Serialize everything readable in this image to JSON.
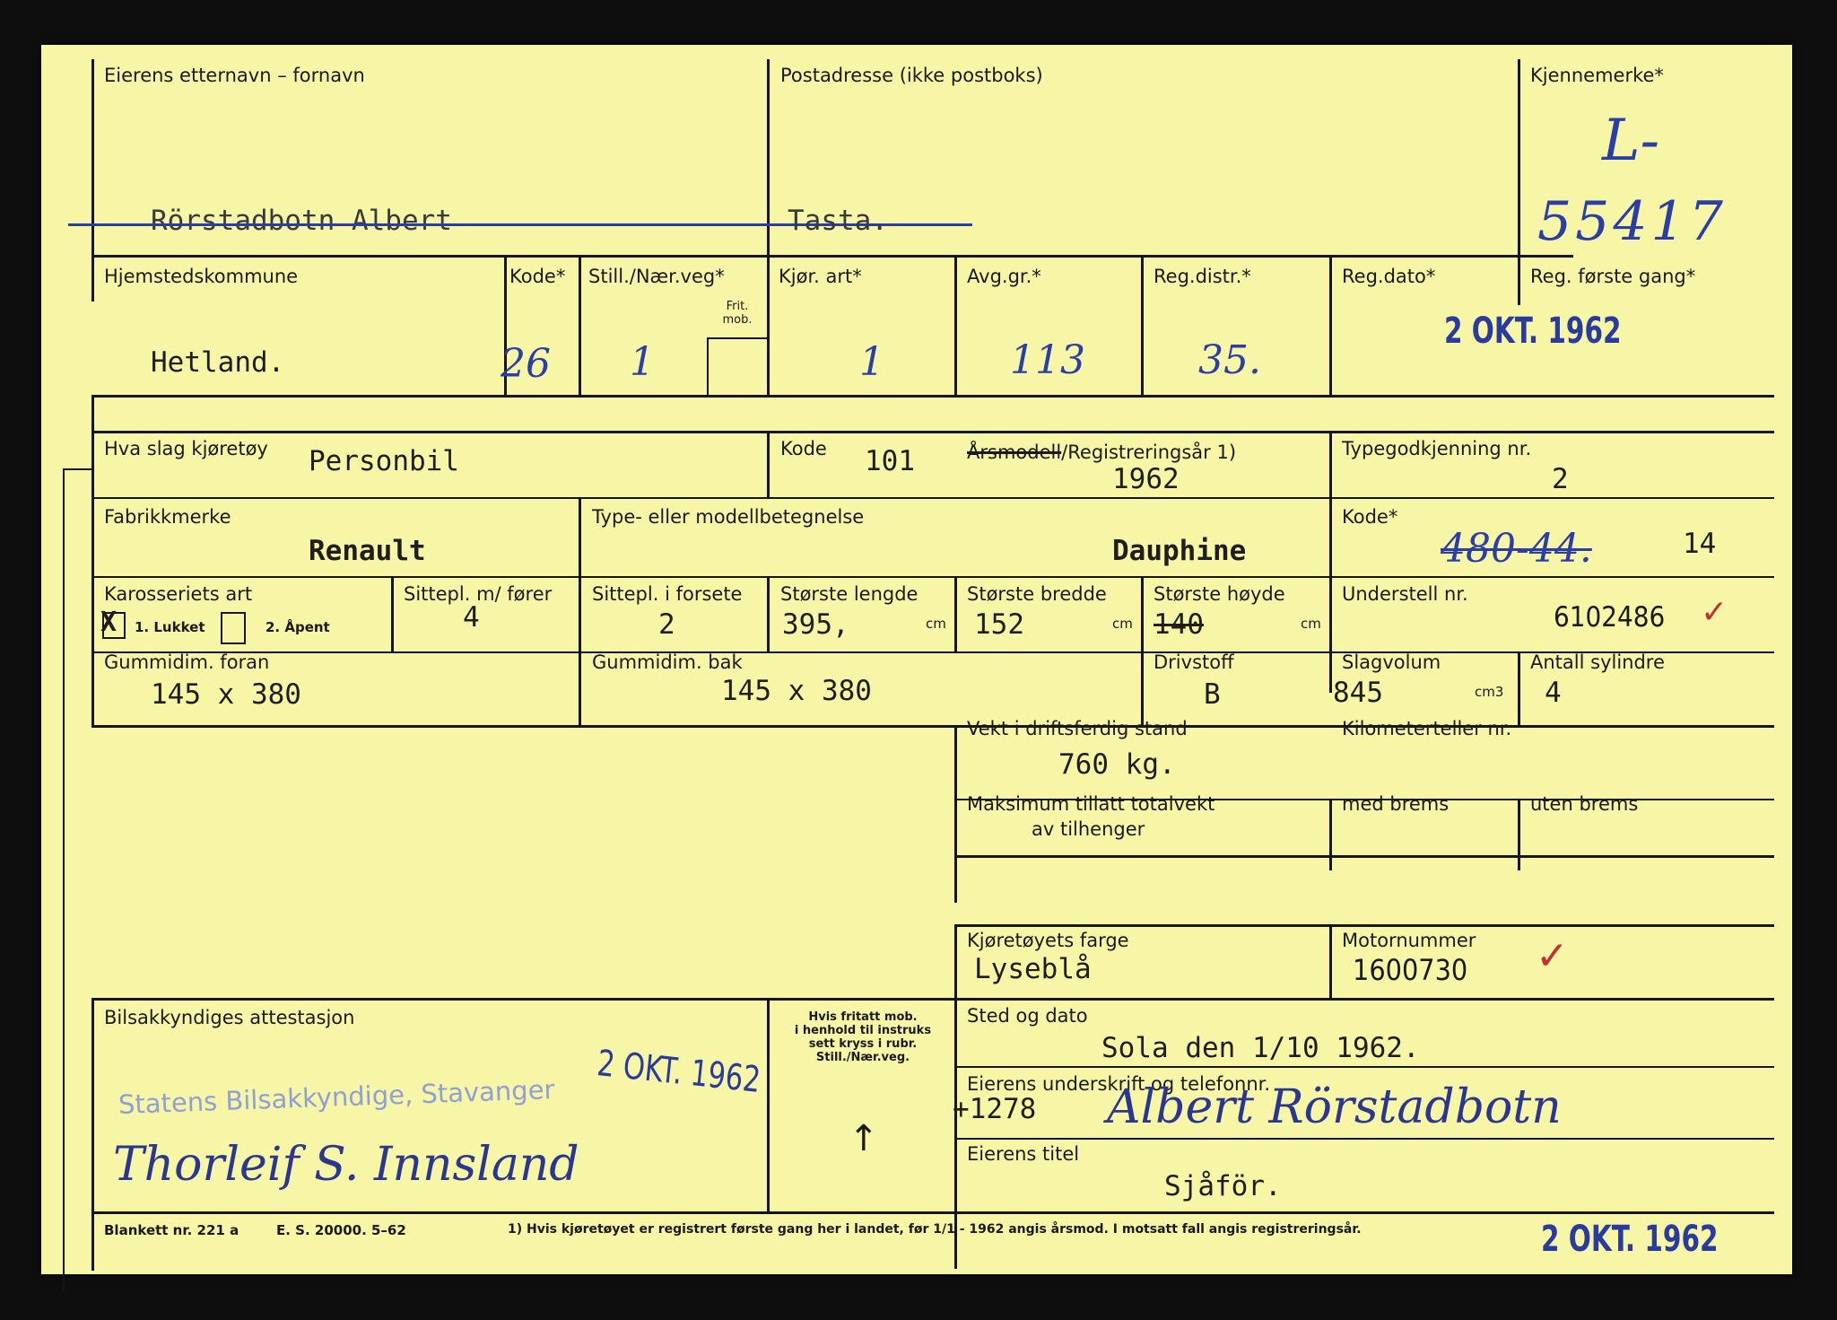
{
  "header": {
    "owner_label": "Eierens etternavn – fornavn",
    "owner_value": "Rörstadbotn Albert",
    "address_label": "Postadresse (ikke postboks)",
    "address_value": "Tasta.",
    "plate_label": "Kjennemerke*",
    "plate_prefix": "L-",
    "plate_number": "55417"
  },
  "row2": {
    "municipality_label": "Hjemstedskommune",
    "municipality_value": "Hetland.",
    "kode_label": "Kode*",
    "kode_value": "26",
    "still_label": "Still./Nær.veg*",
    "still_value": "1",
    "frit_label": "Frit. mob.",
    "kjor_label": "Kjør. art*",
    "kjor_value": "1",
    "avg_label": "Avg.gr.*",
    "avg_value": "113",
    "regdistr_label": "Reg.distr.*",
    "regdistr_value": "35.",
    "regdato_label": "Reg.dato*",
    "regforste_label": "Reg. første gang*",
    "regdato_stamp": "2 OKT. 1962"
  },
  "vehicle": {
    "type_label": "Hva slag kjøretøy",
    "type_value": "Personbil",
    "kode_label": "Kode",
    "kode_value": "101",
    "year_label_struck": "Årsmodell",
    "year_label_rest": "/Registreringsår 1)",
    "year_value": "1962",
    "approval_label": "Typegodkjenning nr.",
    "approval_value": "2",
    "make_label": "Fabrikkmerke",
    "make_value": "Renault",
    "model_label": "Type- eller modellbetegnelse",
    "model_value": "Dauphine",
    "kode2_label": "Kode*",
    "kode2_value_struck": "480-44.",
    "kode2_value": "14",
    "body_label": "Karosseriets art",
    "body_opt1_mark": "X",
    "body_opt1": "1. Lukket",
    "body_opt2": "2. Åpent",
    "seats_label": "Sittepl. m/ fører",
    "seats_value": "4",
    "front_seats_label": "Sittepl. i forsete",
    "front_seats_value": "2",
    "length_label": "Største lengde",
    "length_value": "395,",
    "width_label": "Største bredde",
    "width_value": "152",
    "height_label": "Største høyde",
    "height_value": "140",
    "unit_cm": "cm",
    "chassis_label": "Understell nr.",
    "chassis_value": "6102486",
    "tire_front_label": "Gummidim. foran",
    "tire_front_value": "145 x 380",
    "tire_rear_label": "Gummidim. bak",
    "tire_rear_value": "145 x 380",
    "fuel_label": "Drivstoff",
    "fuel_value": "B",
    "displacement_label": "Slagvolum",
    "displacement_value": "845",
    "unit_cm3": "cm3",
    "cylinders_label": "Antall sylindre",
    "cylinders_value": "4",
    "weight_label": "Vekt i driftsferdig stand",
    "weight_value": "760 kg.",
    "odometer_label": "Kilometerteller nr.",
    "trailer_label_1": "Maksimum tillatt totalvekt",
    "trailer_label_2": "av tilhenger",
    "with_brakes_label": "med brems",
    "without_brakes_label": "uten brems",
    "color_label": "Kjøretøyets farge",
    "color_value": "Lyseblå",
    "engine_label": "Motornummer",
    "engine_value": "1600730"
  },
  "attest": {
    "label": "Bilsakkyndiges attestasjon",
    "stamp_office": "Statens Bilsakkyndige, Stavanger",
    "stamp_date": "2 OKT. 1962",
    "signature": "Thorleif S. Innsland",
    "note_1": "Hvis fritatt mob.",
    "note_2": "i henhold til instruks",
    "note_3": "sett kryss i rubr.",
    "note_4": "Still./Nær.veg.",
    "arrow": "↑",
    "place_date_label": "Sted og dato",
    "place_date_value": "Sola den 1/10 1962.",
    "owner_sig_label": "Eierens underskrift og telefonnr.",
    "phone_value": "+1278",
    "owner_signature": "Albert Rörstadbotn",
    "owner_title_label": "Eierens titel",
    "owner_title_value": "Sjåför."
  },
  "footer": {
    "form_no": "Blankett nr. 221 a",
    "print_info": "E. S. 20000. 5–62",
    "footnote": "1) Hvis kjøretøyet er registrert første gang her i landet, før 1/1 - 1962 angis årsmod. I motsatt fall angis registreringsår.",
    "stamp": "2 OKT. 1962"
  },
  "colors": {
    "card": "#f7f5a6",
    "ink": "#2b3ea8",
    "stamp_office": "#8fa0d6"
  }
}
